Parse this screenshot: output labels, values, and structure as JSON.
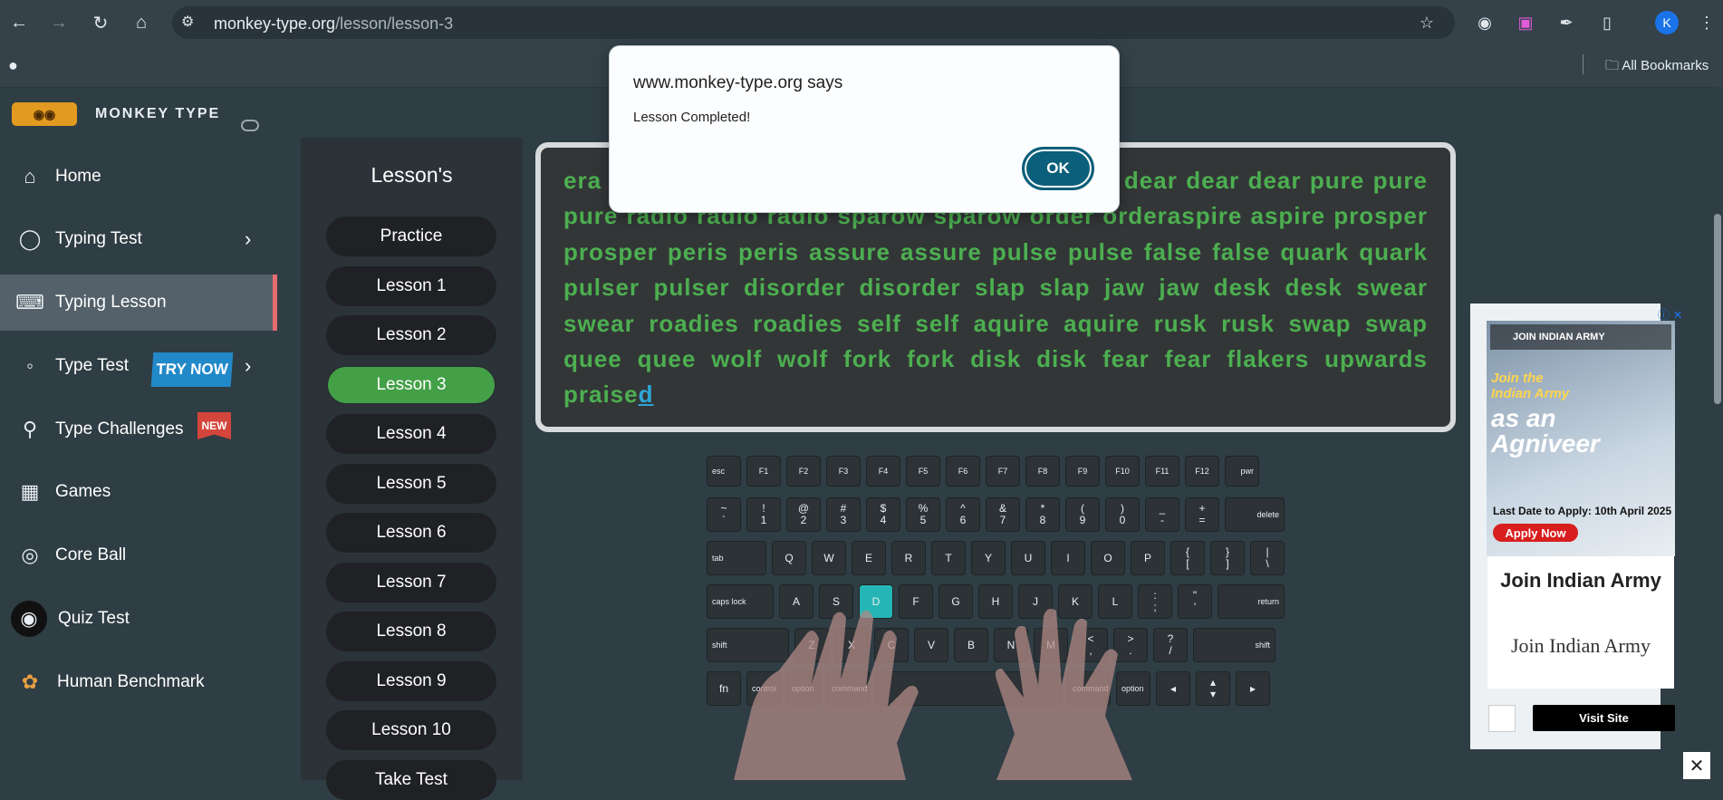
{
  "browser": {
    "url_domain": "monkey-type.org",
    "url_path": "/lesson/lesson-3",
    "profile_initial": "K",
    "bookmarks_label": "All Bookmarks"
  },
  "sidebar": {
    "brand": "MONKEY TYPE",
    "items": [
      {
        "label": "Home"
      },
      {
        "label": "Typing Test"
      },
      {
        "label": "Typing Lesson"
      },
      {
        "label": "Type Test"
      },
      {
        "label": "Type Challenges"
      },
      {
        "label": "Games"
      },
      {
        "label": "Core Ball"
      },
      {
        "label": "Quiz Test"
      },
      {
        "label": "Human Benchmark"
      }
    ],
    "try_now_badge": "TRY NOW",
    "new_badge": "NEW"
  },
  "lessons": {
    "title": "Lesson's",
    "items": [
      "Practice",
      "Lesson 1",
      "Lesson 2",
      "Lesson 3",
      "Lesson 4",
      "Lesson 5",
      "Lesson 6",
      "Lesson 7",
      "Lesson 8",
      "Lesson 9",
      "Lesson 10",
      "Take Test"
    ],
    "active": "Lesson 3"
  },
  "typing": {
    "text": "era ull full loose loose loose laser laser laser dear dear dear pure pure pure radio radio radio sparow sparow order orderaspire aspire prosper prosper peris peris assure assure pulse pulse false false quark quark pulser pulser disorder disorder slap slap jaw jaw desk desk swear swear roadies roadies self self aquire aquire rusk rusk swap swap quee quee wolf wolf fork fork disk disk fear fear flakers upwards praise",
    "cursor_char": "d"
  },
  "keyboard": {
    "highlighted_key": "D",
    "fn_row": [
      "esc",
      "F1",
      "F2",
      "F3",
      "F4",
      "F5",
      "F6",
      "F7",
      "F8",
      "F9",
      "F10",
      "F11",
      "F12",
      "pwr"
    ],
    "num_row": [
      "~\n`",
      "!\n1",
      "@\n2",
      "#\n3",
      "$\n4",
      "%\n5",
      "^\n6",
      "&\n7",
      "*\n8",
      "(\n9",
      ")\n0",
      "_\n-",
      "+\n=",
      "delete"
    ],
    "top_row": [
      "tab",
      "Q",
      "W",
      "E",
      "R",
      "T",
      "Y",
      "U",
      "I",
      "O",
      "P",
      "{\n[",
      "}\n]",
      "|\n\\"
    ],
    "home_row": [
      "caps lock",
      "A",
      "S",
      "D",
      "F",
      "G",
      "H",
      "J",
      "K",
      "L",
      ":\n;",
      "\"\n'",
      "return"
    ],
    "bottom_row": [
      "shift",
      "Z",
      "X",
      "C",
      "V",
      "B",
      "N",
      "M",
      "<\n,",
      ">\n.",
      "?\n/",
      "shift"
    ],
    "space_row": [
      "fn",
      "control",
      "option",
      "command",
      "",
      "command",
      "option",
      "◂",
      "▴\n▾",
      "▸"
    ]
  },
  "dialog": {
    "title": "www.monkey-type.org says",
    "message": "Lesson Completed!",
    "ok_label": "OK"
  },
  "ad": {
    "header": "JOIN INDIAN ARMY",
    "join_line": "Join the\nIndian Army",
    "headline": "as an\nAgniveer",
    "last_date": "Last Date to Apply:  10th April 2025",
    "apply_label": "Apply Now",
    "title1": "Join Indian Army",
    "title2": "Join Indian Army",
    "visit_label": "Visit Site"
  },
  "colors": {
    "accent_green": "#4caf50",
    "active_lesson": "#43a047",
    "sidebar_active_border": "#e46c6c",
    "ok_button": "#0b5f7a"
  }
}
